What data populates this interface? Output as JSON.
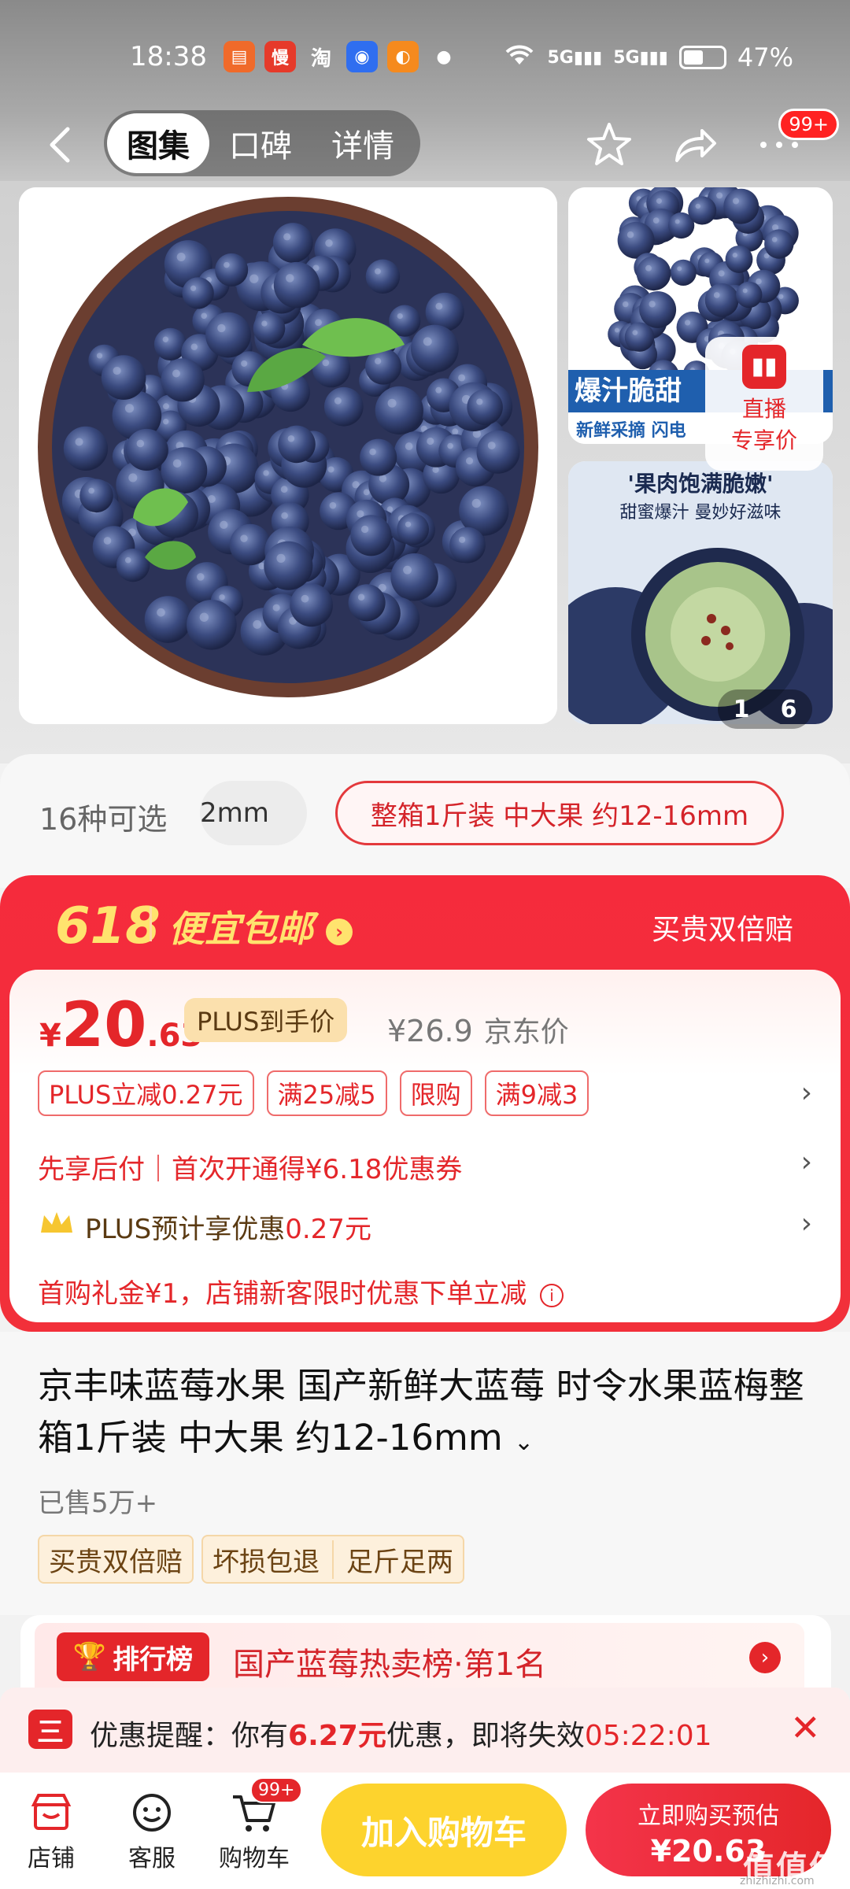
{
  "status": {
    "time": "18:38",
    "battery": "47%",
    "network": "5G"
  },
  "header": {
    "tabs": [
      "图集",
      "口碑",
      "详情"
    ],
    "more_badge": "99+"
  },
  "gallery": {
    "side_top_caption": "爆汁脆甜",
    "side_top_sub": "新鲜采摘 闪电",
    "side_bottom_caption": "'果肉饱满脆嫩'",
    "side_bottom_sub": "甜蜜爆汁 曼妙好滋味",
    "live_label_1": "直播",
    "live_label_2": "专享价",
    "page_current": "1",
    "page_total": "6"
  },
  "variants": {
    "count": "16种可选",
    "option_1": "2mm",
    "option_selected": "整箱1斤装 中大果 约12-16mm"
  },
  "promo": {
    "event": "618",
    "label": "便宜包邮",
    "right": "买贵双倍赔"
  },
  "price": {
    "currency": "¥",
    "integer": "20",
    "decimal": ".63",
    "plus_label": "PLUS到手价",
    "original": "¥26.9",
    "original_label": "京东价",
    "coupons": [
      "PLUS立减0.27元",
      "满25减5",
      "限购",
      "满9减3"
    ],
    "pay_later": "先享后付｜首次开通得¥6.18优惠券",
    "plus_estimate_prefix": "PLUS预计享优惠",
    "plus_estimate_value": "0.27元",
    "first_buy": "首购礼金¥1，店铺新客限时优惠下单立减"
  },
  "product": {
    "title": "京丰味蓝莓水果 国产新鲜大蓝莓 时令水果蓝梅整箱1斤装 中大果 约12-16mm",
    "sold": "已售5万+",
    "tags": [
      "买贵双倍赔",
      "坏损包退",
      "足斤足两"
    ]
  },
  "ranking": {
    "badge": "排行榜",
    "text": "国产蓝莓热卖榜·第1名"
  },
  "reminder": {
    "icon_text": "三",
    "prefix": "优惠提醒：你有",
    "amount": "6.27元",
    "middle": "优惠，即将失效",
    "countdown": "05:22:01"
  },
  "bottom": {
    "store": "店铺",
    "service": "客服",
    "cart": "购物车",
    "cart_badge": "99+",
    "add_cart": "加入购物车",
    "buy_line1": "立即购买预估",
    "buy_line2": "¥20.63"
  },
  "watermark": {
    "text": "值值值",
    "sub": "zhizhizhi.com"
  },
  "colors": {
    "accent_red": "#e4262a",
    "promo_yellow": "#ffe36e",
    "add_cart_yellow": "#fdd32d"
  }
}
